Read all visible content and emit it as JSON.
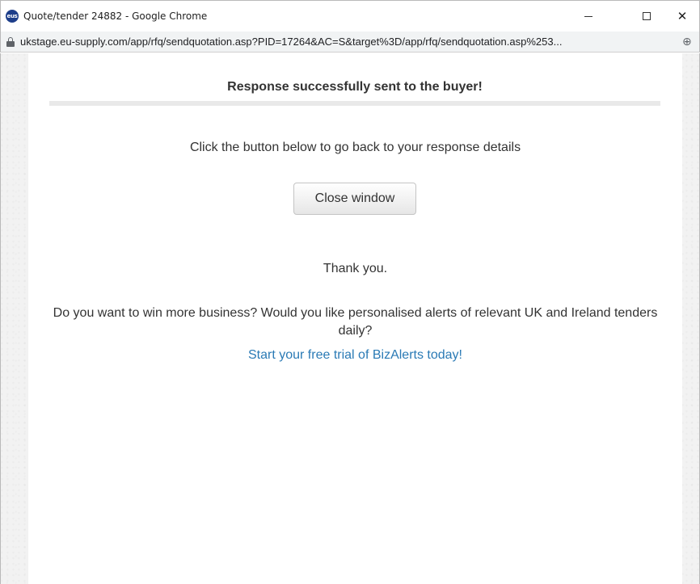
{
  "window": {
    "favicon_text": "eus",
    "title": "Quote/tender 24882 - Google Chrome",
    "controls": {
      "minimize_icon": "minimize-icon",
      "maximize_icon": "maximize-icon",
      "close_glyph": "✕"
    }
  },
  "addressbar": {
    "lock_icon": "lock-icon",
    "url": "ukstage.eu-supply.com/app/rfq/sendquotation.asp?PID=17264&AC=S&target%3D/app/rfq/sendquotation.asp%253...",
    "zoom_glyph": "⊕"
  },
  "page": {
    "heading": "Response successfully sent to the buyer!",
    "instructions": "Click the button below to go back to your response details",
    "close_button_label": "Close window",
    "thank_you": "Thank you.",
    "promo_text": "Do you want to win more business? Would you like personalised alerts of relevant UK and Ireland tenders daily?",
    "promo_link_text": "Start your free trial of BizAlerts today!"
  },
  "colors": {
    "text": "#333333",
    "link": "#2a7ab5",
    "page_background": "#f2f2f2"
  }
}
